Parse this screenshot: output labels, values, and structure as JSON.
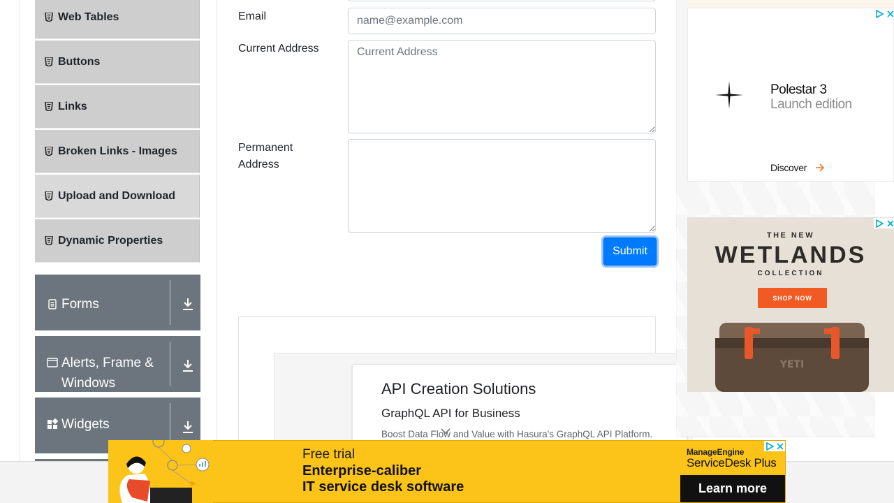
{
  "sidebar": {
    "items": [
      {
        "label": "Web Tables",
        "icon": "html5-icon"
      },
      {
        "label": "Buttons",
        "icon": "html5-icon"
      },
      {
        "label": "Links",
        "icon": "html5-icon"
      },
      {
        "label": "Broken Links - Images",
        "icon": "html5-icon"
      },
      {
        "label": "Upload and Download",
        "icon": "html5-icon"
      },
      {
        "label": "Dynamic Properties",
        "icon": "html5-icon"
      }
    ],
    "groups": [
      {
        "label": "Forms",
        "icon": "document-icon"
      },
      {
        "label": "Alerts, Frame & Windows",
        "icon": "window-icon"
      },
      {
        "label": "Widgets",
        "icon": "widgets-icon"
      }
    ]
  },
  "form": {
    "email_label": "Email",
    "email_placeholder": "name@example.com",
    "current_address_label": "Current Address",
    "current_address_placeholder": "Current Address",
    "permanent_address_label": "Permanent Address",
    "submit_label": "Submit"
  },
  "inline_ad": {
    "title": "API Creation Solutions",
    "subtitle": "GraphQL API for Business",
    "description": "Boost Data Flow and Value with Hasura's GraphQL API Platform."
  },
  "ad_polestar": {
    "name": "Polestar 3",
    "edition": "Launch edition",
    "cta": "Discover",
    "accent_color": "#e57b2d"
  },
  "ad_wetlands": {
    "eyebrow": "THE NEW",
    "title": "WETLANDS",
    "collection": "COLLECTION",
    "cta": "SHOP NOW",
    "accent_color": "#f15a22"
  },
  "bottom_banner": {
    "free_trial": "Free trial",
    "line1": "Enterprise-caliber",
    "line2": "IT service desk software",
    "brand": "ManageEngine",
    "product": "ServiceDesk Plus",
    "cta": "Learn more",
    "background_color": "#fcc419"
  },
  "colors": {
    "primary": "#007bff",
    "group_bg": "#6c757d",
    "item_bg": "#cecece"
  }
}
